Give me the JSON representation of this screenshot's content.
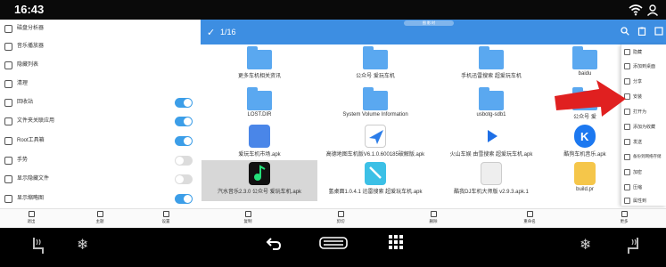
{
  "status_bar": {
    "time": "16:43"
  },
  "left_panel": {
    "items": [
      {
        "label": "磁盘分析器",
        "toggle": null
      },
      {
        "label": "音乐播放器",
        "toggle": null
      },
      {
        "label": "隐藏列表",
        "toggle": null
      },
      {
        "label": "清理",
        "toggle": null
      },
      {
        "label": "回收站",
        "toggle": "on"
      },
      {
        "label": "文件夹关联应用",
        "toggle": "on"
      },
      {
        "label": "Root工具箱",
        "toggle": "on"
      },
      {
        "label": "手势",
        "toggle": "off"
      },
      {
        "label": "显示隐藏文件",
        "toggle": "off"
      },
      {
        "label": "显示缩略图",
        "toggle": "on"
      }
    ]
  },
  "bottom_nav": {
    "left": [
      "退出",
      "主题",
      "设置"
    ],
    "right": [
      "复制",
      "剪切",
      "删除",
      "重命名",
      "更多"
    ]
  },
  "header": {
    "count": "1/16",
    "pill": "图 影 时"
  },
  "files": [
    {
      "name": "更多车机相关资讯",
      "type": "folder"
    },
    {
      "name": "公众号 爱玩车机",
      "type": "folder"
    },
    {
      "name": "手机迅雷搜索 超爱玩车机",
      "type": "folder"
    },
    {
      "name": "baidu",
      "type": "folder"
    },
    {
      "name": "LOST.DIR",
      "type": "folder"
    },
    {
      "name": "System Volume Information",
      "type": "folder"
    },
    {
      "name": "usbotg-sdb1",
      "type": "folder"
    },
    {
      "name": "公众号 爱",
      "type": "folder"
    },
    {
      "name": "爱玩车机市场.apk",
      "type": "apk",
      "color": "#4a86e8"
    },
    {
      "name": "高德地图车机版V6.1.0.600185破解版.apk",
      "type": "apk",
      "color": "#2b7de9"
    },
    {
      "name": "火山车娱 由雪搜索 超爱玩车机.apk",
      "type": "apk",
      "color": "#ffffff"
    },
    {
      "name": "酷狗车机音乐.apk",
      "type": "apk",
      "color": "#1c78f0"
    },
    {
      "name": "汽水音乐2.3.0 公众号 爱玩车机.apk",
      "type": "apk",
      "color": "#111111"
    },
    {
      "name": "氢桌面1.0.4.1 迅雷搜索 超爱玩车机.apk",
      "type": "apk",
      "color": "#3cc0e6"
    },
    {
      "name": "酷我DJ车机大师版 v2.9.3.apk.1",
      "type": "apk",
      "color": "#eeeeee"
    },
    {
      "name": "build.pr",
      "type": "apk",
      "color": "#f5c64a"
    }
  ],
  "context_menu": [
    "隐藏",
    "添加到桌面",
    "分享",
    "安装",
    "打开为",
    "添加为收藏",
    "发送",
    "备份到网络存储",
    "加密",
    "压缩",
    "属性到"
  ],
  "colors": {
    "accent": "#3d8ee2",
    "folder": "#5aa8f0",
    "toggle_on": "#3c9ee8",
    "arrow": "#e02020"
  }
}
